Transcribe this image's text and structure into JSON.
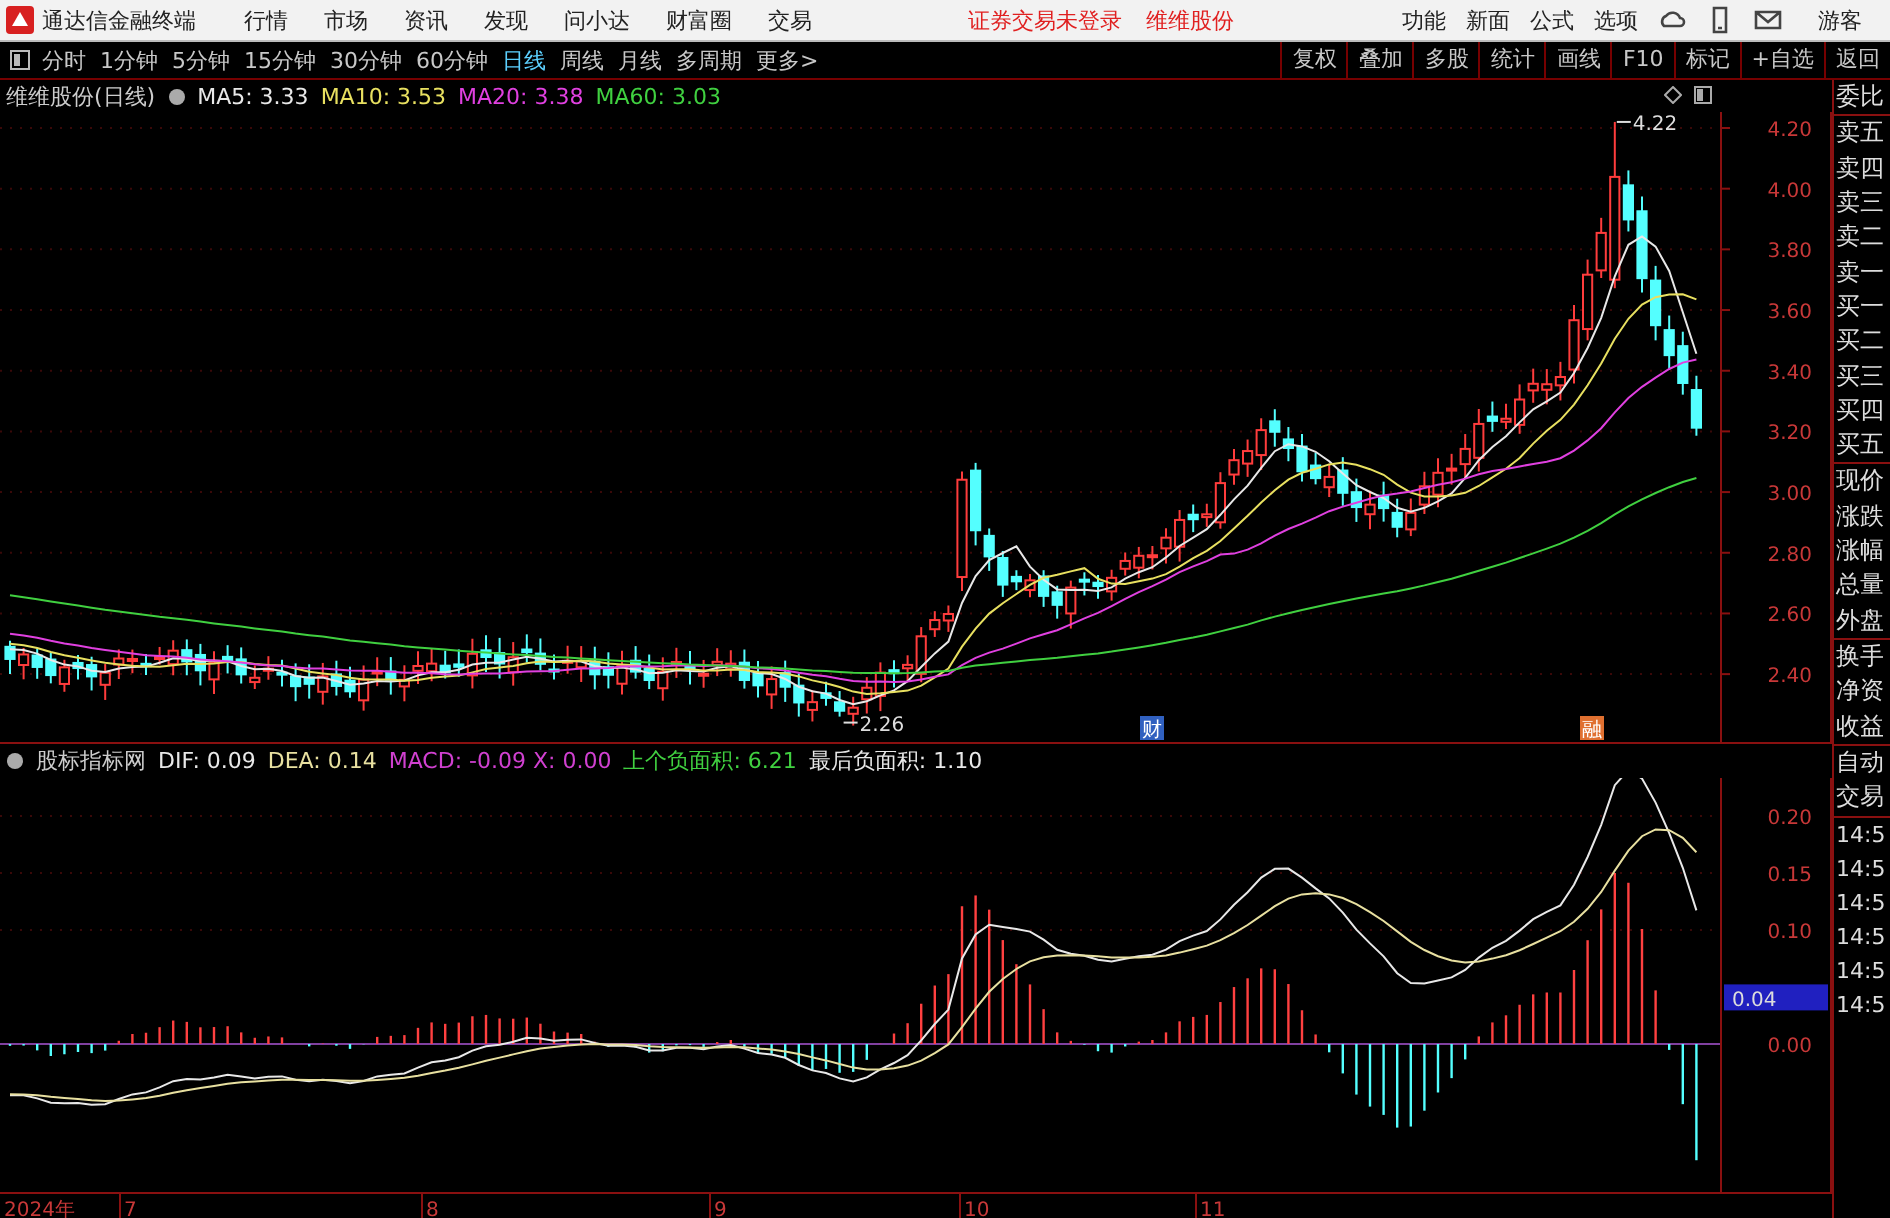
{
  "app": {
    "title": "通达信金融终端",
    "menu": [
      "行情",
      "市场",
      "资讯",
      "发现",
      "问小达",
      "财富圈",
      "交易"
    ],
    "notice": "证券交易未登录",
    "stock": "维维股份",
    "right_menu": [
      "功能",
      "新面",
      "公式",
      "选项"
    ],
    "user": "游客"
  },
  "toolbar": {
    "periods": [
      {
        "label": "分时",
        "selected": false
      },
      {
        "label": "1分钟",
        "selected": false
      },
      {
        "label": "5分钟",
        "selected": false
      },
      {
        "label": "15分钟",
        "selected": false
      },
      {
        "label": "30分钟",
        "selected": false
      },
      {
        "label": "60分钟",
        "selected": false
      },
      {
        "label": "日线",
        "selected": true
      },
      {
        "label": "周线",
        "selected": false
      },
      {
        "label": "月线",
        "selected": false
      },
      {
        "label": "多周期",
        "selected": false
      },
      {
        "label": "更多>",
        "selected": false
      }
    ],
    "buttons": [
      "复权",
      "叠加",
      "多股",
      "统计",
      "画线",
      "F10",
      "标记",
      "+自选",
      "返回"
    ]
  },
  "price_chart": {
    "title": "维维股份(日线)",
    "legend": [
      {
        "label": "MA5: 3.33",
        "color": "#e8e8e8"
      },
      {
        "label": "MA10: 3.53",
        "color": "#e8e060"
      },
      {
        "label": "MA20: 3.38",
        "color": "#e040e0"
      },
      {
        "label": "MA60: 3.03",
        "color": "#40d040"
      }
    ],
    "yticks": [
      "4.20",
      "4.00",
      "3.80",
      "3.60",
      "3.40",
      "3.20",
      "3.00",
      "2.80",
      "2.60",
      "2.40"
    ],
    "high_label": "4.22",
    "low_label": "2.26",
    "markers": [
      {
        "label": "财",
        "color": "#3060c0"
      },
      {
        "label": "融",
        "color": "#e07030"
      }
    ]
  },
  "macd_chart": {
    "title": "股标指标网",
    "legend": [
      {
        "label": "DIF: 0.09",
        "color": "#e8e8e8"
      },
      {
        "label": "DEA: 0.14",
        "color": "#e8e0a0"
      },
      {
        "label": "MACD: -0.09 X: 0.00",
        "color": "#d040d0"
      },
      {
        "label": "上个负面积: 6.21",
        "color": "#40d040"
      },
      {
        "label": "最后负面积: 1.10",
        "color": "#e8e8e8"
      }
    ],
    "yticks": [
      "0.20",
      "0.15",
      "0.10",
      "0.00"
    ],
    "current": "0.04"
  },
  "xaxis": [
    "2024年",
    "7",
    "8",
    "9",
    "10",
    "11"
  ],
  "quote_panel": {
    "labels": [
      "委比",
      "卖五",
      "卖四",
      "卖三",
      "卖二",
      "卖一",
      "买一",
      "买二",
      "买三",
      "买四",
      "买五",
      "现价",
      "涨跌",
      "涨幅",
      "总量",
      "外盘",
      "换手",
      "净资",
      "收益"
    ],
    "trade_labels": [
      "自动",
      "交易"
    ],
    "times": [
      "14:5",
      "14:5",
      "14:5",
      "14:5",
      "14:5",
      "14:5"
    ]
  }
}
